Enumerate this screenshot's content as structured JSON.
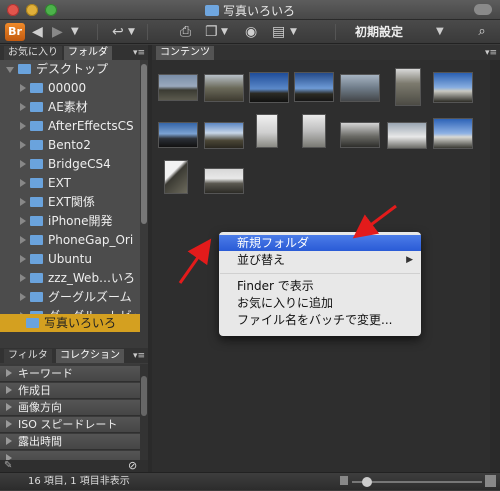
{
  "window": {
    "title": "写真いろいろ"
  },
  "toolbar": {
    "logo": "Br",
    "workspace": "初期設定"
  },
  "left_tabs": [
    "お気に入り",
    "フォルダ"
  ],
  "content_tab": "コンテンツ",
  "folder_tree": {
    "root": "デスクトップ",
    "items": [
      "00000",
      "AE素材",
      "AfterEffectsCS",
      "Bento2",
      "BridgeCS4",
      "EXT",
      "EXT関係",
      "iPhone開発",
      "PhoneGap_Ori",
      "Ubuntu",
      "zzz_Web…いろ",
      "グーグルズーム",
      "グーグル…トビュ",
      "写真いろいろ"
    ],
    "selected": "写真いろいろ"
  },
  "bottom_tabs": [
    "フィルタ",
    "コレクション"
  ],
  "filters": [
    "キーワード",
    "作成日",
    "画像方向",
    "ISO スピードレート",
    "露出時間"
  ],
  "context_menu": {
    "items": [
      "新規フォルダ",
      "並び替え",
      "Finder で表示",
      "お気に入りに追加",
      "ファイル名をバッチで変更..."
    ],
    "highlighted": "新規フォルダ"
  },
  "status": {
    "text": "16 項目, 1 項目非表示"
  }
}
